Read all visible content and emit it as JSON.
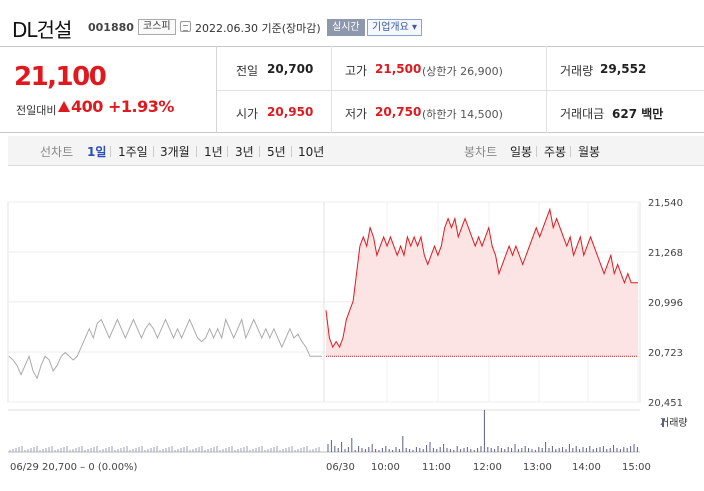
{
  "stock": {
    "name": "DL건설",
    "code": "001880",
    "market": "코스피",
    "date_text": "2022.06.30 기준(장마감)",
    "realtime_label": "실시간",
    "company_label": "기업개요 ▾"
  },
  "price": {
    "current": "21,100",
    "change_label": "전일대비",
    "change_value": "400",
    "change_pct": "+1.93%"
  },
  "stats": {
    "prev_label": "전일",
    "prev_value": "20,700",
    "high_label": "고가",
    "high_value": "21,500",
    "upper_limit": "(상한가 26,900)",
    "volume_label": "거래량",
    "volume_value": "29,552",
    "open_label": "시가",
    "open_value": "20,950",
    "low_label": "저가",
    "low_value": "20,750",
    "lower_limit": "(하한가 14,500)",
    "amount_label": "거래대금",
    "amount_value": "627 백만"
  },
  "toolbar": {
    "line_chart_label": "선차트",
    "periods": [
      "1일",
      "1주일",
      "3개월",
      "1년",
      "3년",
      "5년",
      "10년"
    ],
    "selected_period": "1일",
    "candle_label": "봉차트",
    "candles": [
      "일봉",
      "주봉",
      "월봉"
    ]
  },
  "colors": {
    "up": "#e0191e",
    "accent": "#2a4db8",
    "prev_line": "#aaaaaa",
    "volume": "#5b5f8a"
  },
  "chart_data": {
    "type": "line",
    "y_ticks": [
      "21,540",
      "21,268",
      "20,996",
      "20,723",
      "20,451"
    ],
    "ylim": [
      20451,
      21540
    ],
    "x_ticks": [
      "06/29",
      "06/30",
      "10:00",
      "11:00",
      "12:00",
      "13:00",
      "14:00",
      "15:00"
    ],
    "prev_day_caption": "06/29  20,700 – 0 (0.00%)",
    "volume_legend": "거래량",
    "prev_close": 20700,
    "series": [
      {
        "name": "06/29",
        "values": [
          20700,
          20680,
          20650,
          20600,
          20650,
          20700,
          20620,
          20580,
          20650,
          20700,
          20680,
          20620,
          20650,
          20700,
          20720,
          20700,
          20680,
          20700,
          20750,
          20800,
          20850,
          20800,
          20880,
          20900,
          20850,
          20800,
          20850,
          20900,
          20850,
          20800,
          20850,
          20900,
          20850,
          20800,
          20850,
          20880,
          20850,
          20800,
          20850,
          20900,
          20850,
          20800,
          20850,
          20800,
          20850,
          20900,
          20850,
          20800,
          20780,
          20800,
          20850,
          20800,
          20850,
          20800,
          20900,
          20850,
          20800,
          20850,
          20900,
          20800,
          20850,
          20900,
          20850,
          20800,
          20850,
          20800,
          20850,
          20800,
          20750,
          20800,
          20850,
          20800,
          20820,
          20780,
          20750,
          20700,
          20700,
          20700,
          20700
        ]
      },
      {
        "name": "06/30",
        "values": [
          20950,
          20800,
          20750,
          20780,
          20750,
          20800,
          20900,
          20950,
          21000,
          21150,
          21300,
          21350,
          21300,
          21400,
          21350,
          21250,
          21300,
          21350,
          21300,
          21350,
          21300,
          21250,
          21300,
          21250,
          21350,
          21300,
          21350,
          21300,
          21350,
          21250,
          21200,
          21250,
          21300,
          21250,
          21300,
          21400,
          21450,
          21400,
          21450,
          21350,
          21400,
          21450,
          21400,
          21350,
          21300,
          21350,
          21300,
          21350,
          21400,
          21300,
          21250,
          21150,
          21200,
          21250,
          21300,
          21250,
          21300,
          21250,
          21200,
          21250,
          21300,
          21350,
          21400,
          21350,
          21400,
          21450,
          21500,
          21400,
          21450,
          21400,
          21350,
          21300,
          21350,
          21250,
          21300,
          21350,
          21250,
          21300,
          21350,
          21300,
          21250,
          21200,
          21150,
          21200,
          21250,
          21150,
          21200,
          21150,
          21100,
          21150,
          21100,
          21100,
          21100
        ]
      }
    ]
  }
}
